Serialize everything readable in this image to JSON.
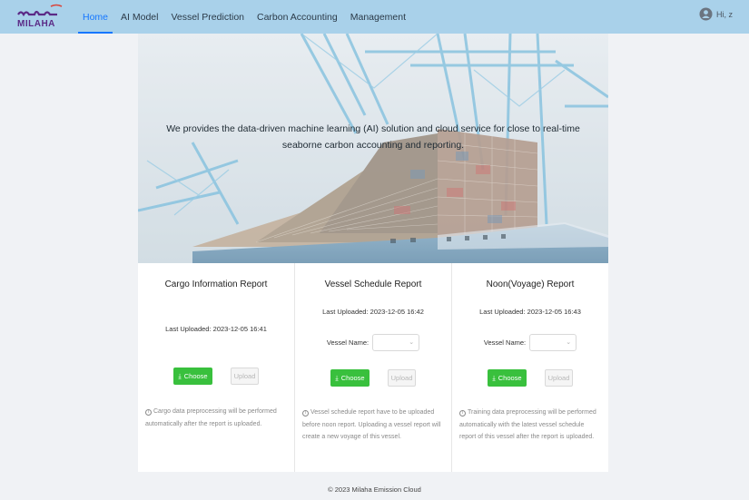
{
  "header": {
    "logo_text": "MILAHA",
    "nav": [
      {
        "label": "Home",
        "active": true
      },
      {
        "label": "AI Model",
        "active": false
      },
      {
        "label": "Vessel Prediction",
        "active": false
      },
      {
        "label": "Carbon Accounting",
        "active": false
      },
      {
        "label": "Management",
        "active": false
      }
    ],
    "user": {
      "greeting": "Hi, z",
      "icon": "user-avatar-icon"
    }
  },
  "hero": {
    "text": "We provides the data-driven machine learning (AI) solution and cloud service for close to real-time seaborne carbon accounting and reporting."
  },
  "panels": [
    {
      "title": "Cargo Information Report",
      "last_uploaded": "Last Uploaded: 2023-12-05 16:41",
      "has_vessel_select": false,
      "vessel_label": "",
      "choose_label": "Choose",
      "upload_label": "Upload",
      "note": "Cargo data preprocessing will be performed automatically after the report is uploaded."
    },
    {
      "title": "Vessel Schedule Report",
      "last_uploaded": "Last Uploaded: 2023-12-05 16:42",
      "has_vessel_select": true,
      "vessel_label": "Vessel Name:",
      "choose_label": "Choose",
      "upload_label": "Upload",
      "note": "Vessel schedule report have to be uploaded before noon report. Uploading a vessel report will create a new voyage of this vessel."
    },
    {
      "title": "Noon(Voyage) Report",
      "last_uploaded": "Last Uploaded: 2023-12-05 16:43",
      "has_vessel_select": true,
      "vessel_label": "Vessel Name:",
      "choose_label": "Choose",
      "upload_label": "Upload",
      "note": "Training data preprocessing will be performed automatically with the latest vessel schedule report of this vessel after the report is uploaded."
    }
  ],
  "footer": {
    "text": "© 2023 Milaha Emission Cloud"
  },
  "colors": {
    "header_bg": "#a9d1ea",
    "accent": "#1677ff",
    "choose_green": "#39c03d",
    "logo_purple": "#5b2a86",
    "logo_red": "#d9453c"
  }
}
